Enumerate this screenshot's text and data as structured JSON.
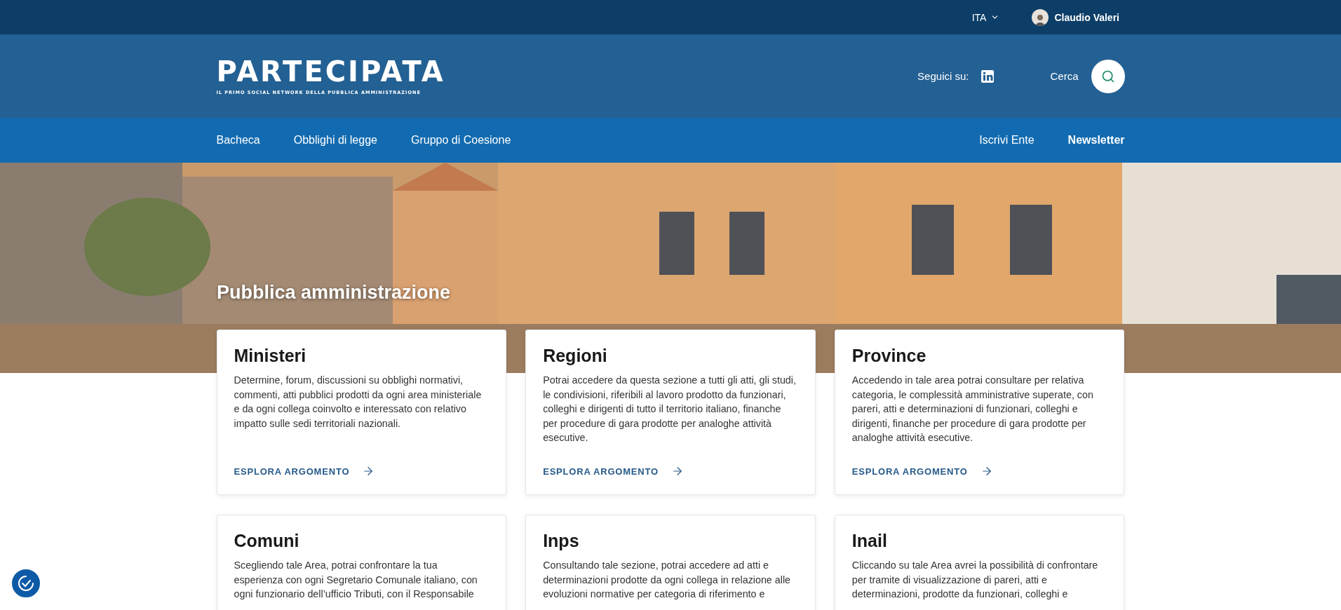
{
  "top_bar": {
    "language": "ITA",
    "user": {
      "name": "Claudio Valeri"
    }
  },
  "header": {
    "logo": {
      "title": "PARTECIPATA",
      "tagline": "IL PRIMO SOCIAL NETWORK DELLA PUBBLICA AMMINISTRAZIONE"
    },
    "follow_label": "Seguici su:",
    "search_label": "Cerca"
  },
  "nav": {
    "left": [
      {
        "label": "Bacheca"
      },
      {
        "label": "Obblighi di legge"
      },
      {
        "label": "Gruppo di Coesione"
      }
    ],
    "right": [
      {
        "label": "Iscrivi Ente",
        "bold": false
      },
      {
        "label": "Newsletter",
        "bold": true
      }
    ]
  },
  "hero": {
    "kind": "picture",
    "title": "Pubblica amministrazione"
  },
  "cards": [
    {
      "title": "Ministeri",
      "text": "Determine, forum, discussioni su obblighi normativi, commenti, atti pubblici prodotti da ogni area ministeriale e da ogni collega coinvolto e interessato con relativo impatto sulle sedi territoriali nazionali.",
      "link": "ESPLORA ARGOMENTO"
    },
    {
      "title": "Regioni",
      "text": "Potrai accedere da questa sezione a tutti gli atti, gli studi, le condivisioni, riferibili al lavoro prodotto da funzionari, colleghi e dirigenti di tutto il territorio italiano, finanche per procedure di gara prodotte per analoghe attività esecutive.",
      "link": "ESPLORA ARGOMENTO"
    },
    {
      "title": "Province",
      "text": "Accedendo in tale area potrai consultare per relativa categoria, le complessità amministrative superate, con pareri, atti e determinazioni di funzionari, colleghi e dirigenti, finanche per procedure di gara prodotte per analoghe attività esecutive.",
      "link": "ESPLORA ARGOMENTO"
    },
    {
      "title": "Comuni",
      "text": "Scegliendo tale Area, potrai confrontare la tua esperienza con ogni Segretario Comunale italiano, con ogni funzionario dell’ufficio Tributi, con il Responsabile"
    },
    {
      "title": "Inps",
      "text": "Consultando tale sezione, potrai accedere ad atti e determinazioni prodotte da ogni collega in relazione alle evoluzioni normative per categoria di riferimento e"
    },
    {
      "title": "Inail",
      "text": "Cliccando su tale Area avrei la possibilità di confrontare per tramite di visualizzazione di pareri, atti e determinazioni, prodotte da funzionari, colleghi e"
    }
  ]
}
